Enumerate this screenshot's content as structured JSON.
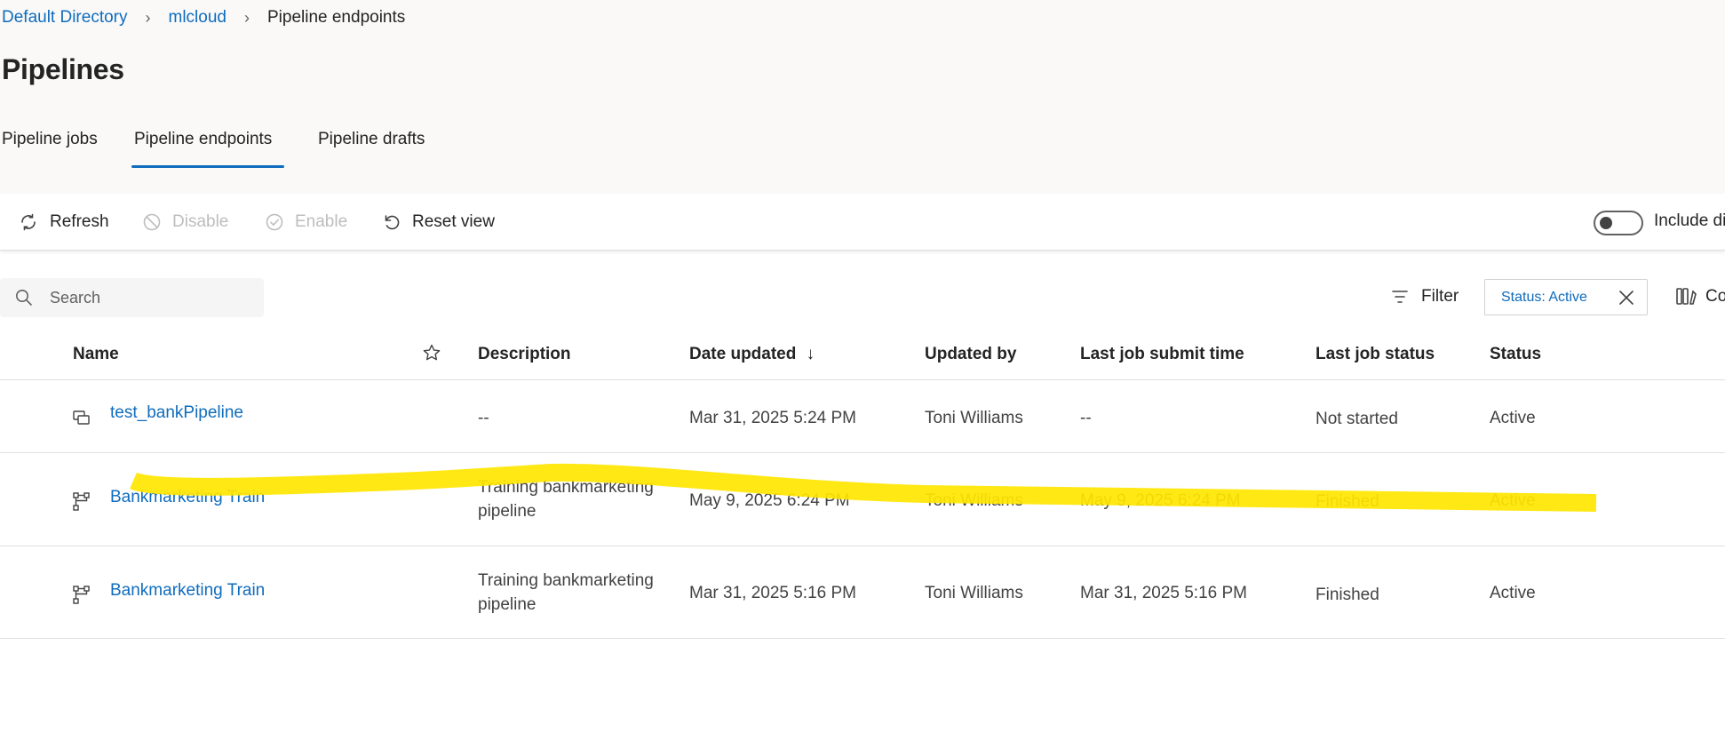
{
  "breadcrumb": {
    "items": [
      "Default Directory",
      "mlcloud"
    ],
    "current": "Pipeline endpoints"
  },
  "page": {
    "title": "Pipelines"
  },
  "tabs": [
    {
      "label": "Pipeline jobs",
      "selected": false
    },
    {
      "label": "Pipeline endpoints",
      "selected": true
    },
    {
      "label": "Pipeline drafts",
      "selected": false
    }
  ],
  "toolbar": {
    "refresh": "Refresh",
    "disable": "Disable",
    "enable": "Enable",
    "reset_view": "Reset view",
    "include_toggle_label": "Include di"
  },
  "search": {
    "placeholder": "Search"
  },
  "filter": {
    "label": "Filter",
    "chip": "Status: Active",
    "columns_label": "Co"
  },
  "table": {
    "headers": {
      "name": "Name",
      "description": "Description",
      "date_updated": "Date updated",
      "updated_by": "Updated by",
      "last_job_submit_time": "Last job submit time",
      "last_job_status": "Last job status",
      "status": "Status"
    },
    "rows": [
      {
        "icon": "pipeline-endpoint-icon",
        "name": "test_bankPipeline",
        "description": "--",
        "date_updated": "Mar 31, 2025 5:24 PM",
        "updated_by": "Toni Williams",
        "last_job_submit_time": "--",
        "last_job_status": "Not started",
        "status": "Active"
      },
      {
        "icon": "pipeline-graph-icon",
        "name": "Bankmarketing Train",
        "description": "Training bankmarketing pipeline",
        "date_updated": "May 9, 2025 6:24 PM",
        "updated_by": "Toni Williams",
        "last_job_submit_time": "May 9, 2025 6:24 PM",
        "last_job_status": "Finished",
        "status": "Active"
      },
      {
        "icon": "pipeline-graph-icon",
        "name": "Bankmarketing Train",
        "description": "Training bankmarketing pipeline",
        "date_updated": "Mar 31, 2025 5:16 PM",
        "updated_by": "Toni Williams",
        "last_job_submit_time": "Mar 31, 2025 5:16 PM",
        "last_job_status": "Finished",
        "status": "Active"
      }
    ]
  },
  "annotation": {
    "highlight_color": "#ffe600"
  }
}
